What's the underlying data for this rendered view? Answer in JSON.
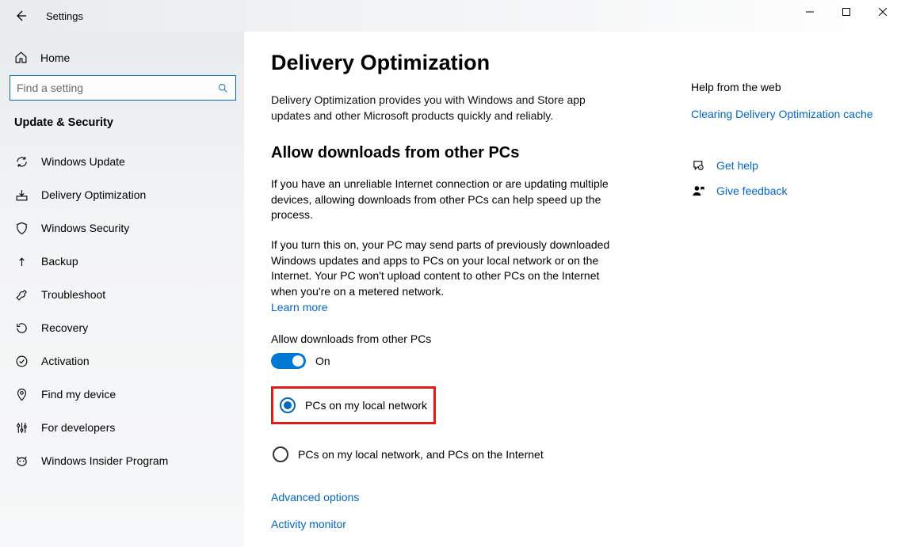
{
  "window": {
    "title": "Settings"
  },
  "sidebar": {
    "home_label": "Home",
    "search_placeholder": "Find a setting",
    "section_title": "Update & Security",
    "items": [
      {
        "label": "Windows Update"
      },
      {
        "label": "Delivery Optimization"
      },
      {
        "label": "Windows Security"
      },
      {
        "label": "Backup"
      },
      {
        "label": "Troubleshoot"
      },
      {
        "label": "Recovery"
      },
      {
        "label": "Activation"
      },
      {
        "label": "Find my device"
      },
      {
        "label": "For developers"
      },
      {
        "label": "Windows Insider Program"
      }
    ]
  },
  "page": {
    "title": "Delivery Optimization",
    "description": "Delivery Optimization provides you with Windows and Store app updates and other Microsoft products quickly and reliably.",
    "section_title": "Allow downloads from other PCs",
    "para1": "If you have an unreliable Internet connection or are updating multiple devices, allowing downloads from other PCs can help speed up the process.",
    "para2": "If you turn this on, your PC may send parts of previously downloaded Windows updates and apps to PCs on your local network or on the Internet. Your PC won't upload content to other PCs on the Internet when you're on a metered network.",
    "learn_more": "Learn more",
    "toggle_label": "Allow downloads from other PCs",
    "toggle_state": "On",
    "radio1": "PCs on my local network",
    "radio2": "PCs on my local network, and PCs on the Internet",
    "link_advanced": "Advanced options",
    "link_activity": "Activity monitor"
  },
  "aside": {
    "help_title": "Help from the web",
    "help_link": "Clearing Delivery Optimization cache",
    "get_help": "Get help",
    "give_feedback": "Give feedback"
  }
}
